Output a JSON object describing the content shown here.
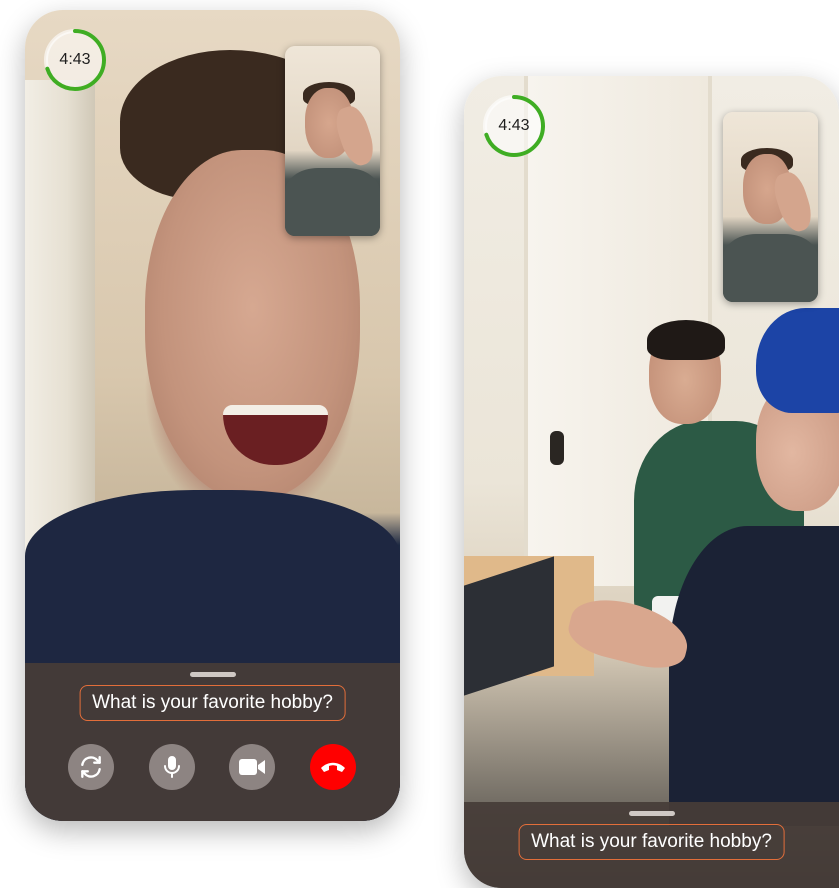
{
  "colors": {
    "timer_ring": "#3fad23",
    "question_border": "#e36e3a",
    "end_call": "#ff0000",
    "control_button": "#8d8482",
    "sheet": "#463c38"
  },
  "screens": [
    {
      "timer": {
        "label": "4:43",
        "progress": 0.7
      },
      "question": "What is your favorite hobby?",
      "controls": [
        {
          "icon": "flip-camera-icon"
        },
        {
          "icon": "microphone-icon"
        },
        {
          "icon": "video-camera-icon"
        },
        {
          "icon": "end-call-icon"
        }
      ]
    },
    {
      "timer": {
        "label": "4:43",
        "progress": 0.7
      },
      "question": "What is your favorite hobby?"
    }
  ]
}
